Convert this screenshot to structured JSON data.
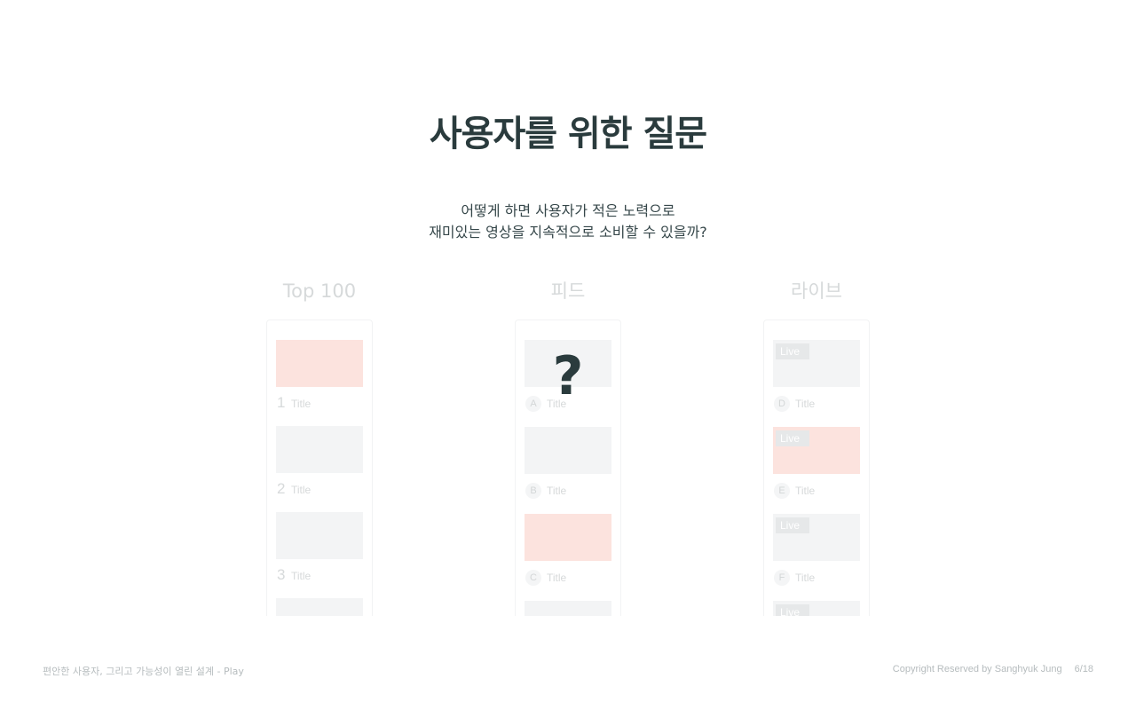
{
  "title": "사용자를 위한 질문",
  "subtitle": {
    "line1": "어떻게 하면 사용자가 적은 노력으로",
    "line2": "재미있는 영상을 지속적으로 소비할 수 있을까?"
  },
  "columns": {
    "top100": {
      "heading": "Top 100",
      "items": [
        {
          "rank": "1",
          "title": "Title"
        },
        {
          "rank": "2",
          "title": "Title"
        },
        {
          "rank": "3",
          "title": "Title"
        }
      ]
    },
    "feed": {
      "heading": "피드",
      "question_mark": "?",
      "items": [
        {
          "letter": "A",
          "title": "Title"
        },
        {
          "letter": "B",
          "title": "Title"
        },
        {
          "letter": "C",
          "title": "Title"
        }
      ]
    },
    "live": {
      "heading": "라이브",
      "badge": "Live",
      "items": [
        {
          "letter": "D",
          "title": "Title"
        },
        {
          "letter": "E",
          "title": "Title"
        },
        {
          "letter": "F",
          "title": "Title"
        }
      ]
    }
  },
  "footer": {
    "left": "편안한 사용자, 그리고 가능성이 열린 설계 - Play",
    "copyright": "Copyright Reserved by Sanghyuk Jung",
    "page": "6/18"
  },
  "colors": {
    "heading": "#2a3b3d",
    "accent_thumb": "#fce3de",
    "thumb": "#f3f4f5"
  }
}
